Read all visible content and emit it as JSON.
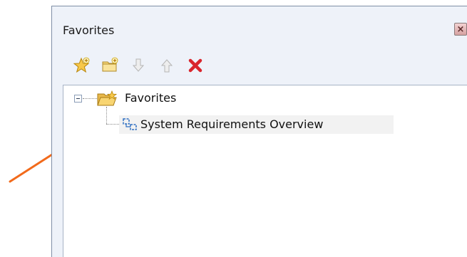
{
  "panel": {
    "title": "Favorites",
    "close_icon": "close-icon",
    "colors": {
      "frame": "#7f8fa6",
      "background": "#eef2f9",
      "arrow": "#f26a1b"
    }
  },
  "toolbar": {
    "buttons": [
      {
        "name": "add-favorite",
        "icon": "star-add-icon"
      },
      {
        "name": "new-folder",
        "icon": "folder-add-icon"
      },
      {
        "name": "move-down",
        "icon": "arrow-down-icon"
      },
      {
        "name": "move-up",
        "icon": "arrow-up-icon"
      },
      {
        "name": "delete",
        "icon": "delete-x-icon"
      }
    ]
  },
  "tree": {
    "root": {
      "label": "Favorites",
      "icon": "open-folder-icon",
      "expanded": true
    },
    "children": [
      {
        "label": "System Requirements Overview",
        "icon": "requirements-diagram-icon"
      }
    ]
  }
}
